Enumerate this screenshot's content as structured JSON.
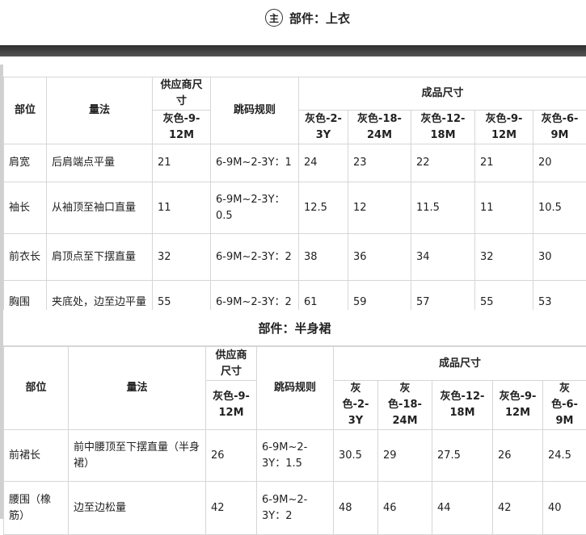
{
  "top": {
    "badge": "主",
    "title": "部件：上衣"
  },
  "table1": {
    "h_part": "部位",
    "h_method": "量法",
    "h_supplier": "供应商尺寸",
    "h_rule": "跳码规则",
    "h_finished": "成品尺寸",
    "supplier_size": "灰色-9-12M",
    "sizes": [
      "灰色-2-3Y",
      "灰色-18-24M",
      "灰色-12-18M",
      "灰色-9-12M",
      "灰色-6-9M"
    ],
    "rows": [
      {
        "part": "肩宽",
        "method": "后肩端点平量",
        "supplier": "21",
        "rule": "6-9M~2-3Y：1",
        "values": [
          "24",
          "23",
          "22",
          "21",
          "20"
        ]
      },
      {
        "part": "袖长",
        "method": "从袖顶至袖口直量",
        "supplier": "11",
        "rule": "6-9M~2-3Y：0.5",
        "values": [
          "12.5",
          "12",
          "11.5",
          "11",
          "10.5"
        ]
      },
      {
        "part": "前衣长",
        "method": "肩顶点至下摆直量",
        "supplier": "32",
        "rule": "6-9M~2-3Y：2",
        "values": [
          "38",
          "36",
          "34",
          "32",
          "30"
        ]
      },
      {
        "part": "胸围",
        "method": "夹底处，边至边平量",
        "supplier": "55",
        "rule": "6-9M~2-3Y：2",
        "values": [
          "61",
          "59",
          "57",
          "55",
          "53"
        ]
      }
    ]
  },
  "section2_title": "部件：半身裙",
  "table2": {
    "h_part": "部位",
    "h_method": "量法",
    "h_supplier": "供应商尺寸",
    "h_rule": "跳码规则",
    "h_finished": "成品尺寸",
    "supplier_size": "灰色-9-12M",
    "sizes": [
      "灰色-2-3Y",
      "灰色-18-24M",
      "灰色-12-18M",
      "灰色-9-12M",
      "灰色-6-9M"
    ],
    "rows": [
      {
        "part": "前裙长",
        "method": "前中腰顶至下摆直量（半身裙）",
        "supplier": "26",
        "rule": "6-9M~2-3Y：1.5",
        "values": [
          "30.5",
          "29",
          "27.5",
          "26",
          "24.5"
        ]
      },
      {
        "part": "腰围（橡筋）",
        "method": "边至边松量",
        "supplier": "42",
        "rule": "6-9M~2-3Y：2",
        "values": [
          "48",
          "46",
          "44",
          "42",
          "40"
        ]
      }
    ]
  }
}
